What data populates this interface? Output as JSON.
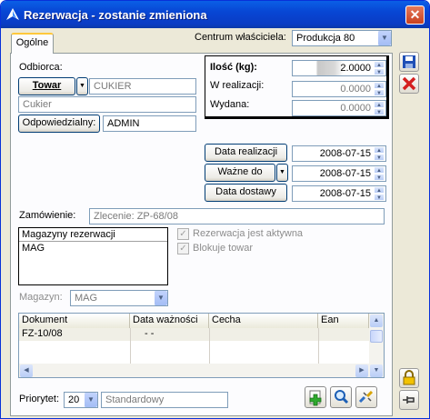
{
  "window": {
    "title": "Rezerwacja - zostanie zmieniona",
    "close_glyph": "✕"
  },
  "tabs": [
    {
      "label": "Ogólne"
    }
  ],
  "centrum": {
    "label": "Centrum właściciela:",
    "value": "Produkcja 80"
  },
  "odbiorca": {
    "label": "Odbiorca:"
  },
  "towar": {
    "button": "Towar",
    "code": "CUKIER",
    "name": "Cukier"
  },
  "odpowiedzialny": {
    "button": "Odpowiedzialny:",
    "value": "ADMIN"
  },
  "ilosc": {
    "label": "Ilość (kg):",
    "value": "2.0000",
    "w_realizacji_label": "W realizacji:",
    "w_realizacji": "0.0000",
    "wydana_label": "Wydana:",
    "wydana": "0.0000"
  },
  "dates": {
    "realizacji_label": "Data realizacji",
    "realizacji": "2008-07-15",
    "wazne_do_label": "Ważne do",
    "wazne_do": "2008-07-15",
    "dostawy_label": "Data dostawy",
    "dostawy": "2008-07-15"
  },
  "zamowienie": {
    "label": "Zamówienie:",
    "value": "Zlecenie: ZP-68/08"
  },
  "magazyny": {
    "label": "Magazyny rezerwacji",
    "items": [
      "MAG"
    ]
  },
  "checks": {
    "aktywna": "Rezerwacja jest aktywna",
    "blokuje": "Blokuje towar"
  },
  "magazyn": {
    "label": "Magazyn:",
    "value": "MAG"
  },
  "grid": {
    "columns": [
      "Dokument",
      "Data ważności",
      "Cecha",
      "Ean"
    ],
    "rows": [
      [
        "FZ-10/08",
        " - -",
        "",
        ""
      ]
    ]
  },
  "priorytet": {
    "label": "Priorytet:",
    "value": "20",
    "desc": "Standardowy"
  },
  "colors": {
    "titlebar": "#0846d4",
    "accent": "#ffc83c",
    "disabled_text": "#8c8c8c"
  }
}
